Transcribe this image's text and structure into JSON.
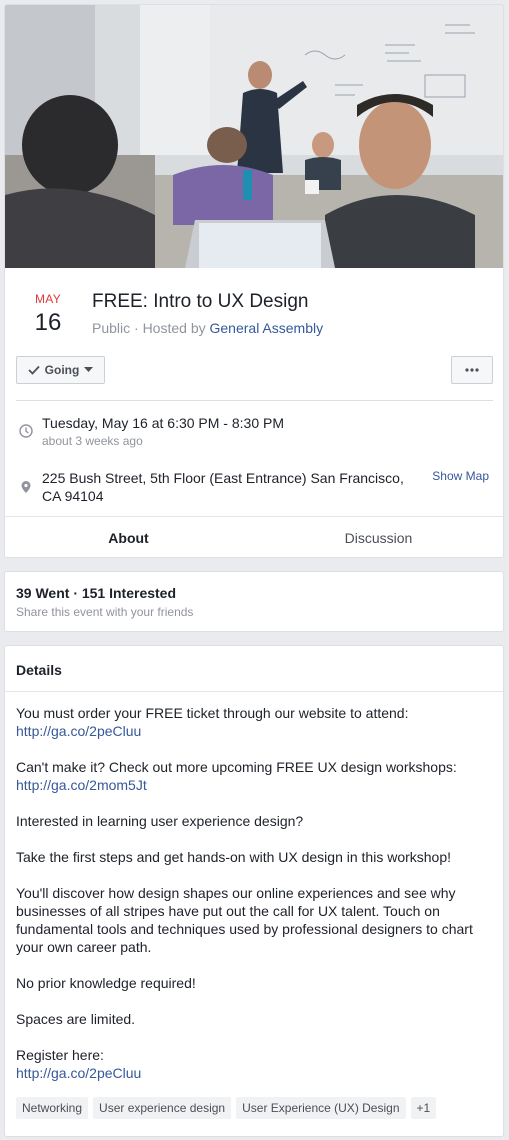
{
  "event": {
    "month": "MAY",
    "day": "16",
    "title": "FREE: Intro to UX Design",
    "privacy_prefix": "Public · Hosted by ",
    "host": "General Assembly",
    "going_label": "Going",
    "time_main": "Tuesday, May 16 at 6:30 PM - 8:30 PM",
    "time_sub": "about 3 weeks ago",
    "address_line1": "225 Bush Street, 5th Floor (East Entrance) San Francisco,",
    "address_line2": "CA 94104",
    "show_map": "Show Map",
    "tabs": [
      {
        "label": "About",
        "active": true
      },
      {
        "label": "Discussion",
        "active": false
      }
    ]
  },
  "stats": {
    "title": "39 Went · 151 Interested",
    "subtitle": "Share this event with your friends"
  },
  "details": {
    "title": "Details",
    "p1_text": "You must order your FREE ticket through our website to attend:",
    "p1_link": "http://ga.co/2peCluu",
    "p2_text": "Can't make it? Check out more upcoming FREE UX design workshops:",
    "p2_link": "http://ga.co/2mom5Jt",
    "p3": "Interested in learning user experience design?",
    "p4": "Take the first steps and get hands-on with UX design in this workshop!",
    "p5": "You'll discover how design shapes our online experiences and see why businesses of all stripes have put out the call for UX talent. Touch on fundamental tools and techniques used by professional designers to chart your own career path.",
    "p6": "No prior knowledge required!",
    "p7": "Spaces are limited.",
    "p8_text": "Register here:",
    "p8_link": "http://ga.co/2peCluu",
    "tags": [
      "Networking",
      "User experience design",
      "User Experience (UX) Design",
      "+1"
    ]
  },
  "icons": {
    "clock": "clock-icon",
    "location": "location-pin-icon",
    "check": "check-icon",
    "caret": "caret-down-icon",
    "more": "more-horizontal-icon"
  },
  "colors": {
    "accent": "#4267b2",
    "link": "#365899",
    "date_month": "#e0393e",
    "background": "#e9ebee"
  }
}
